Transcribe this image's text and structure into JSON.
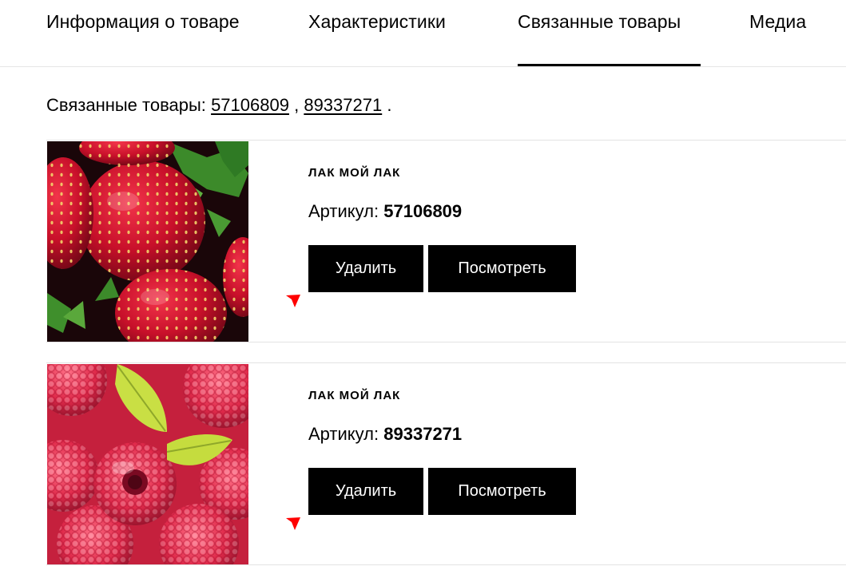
{
  "tabs": [
    {
      "label": "Информация о товаре",
      "active": false
    },
    {
      "label": "Характеристики",
      "active": false
    },
    {
      "label": "Связанные товары",
      "active": true
    },
    {
      "label": "Медиа",
      "active": false
    }
  ],
  "related": {
    "prefix": "Связанные товары:",
    "links": [
      "57106809",
      "89337271"
    ],
    "separator": ",",
    "suffix": "."
  },
  "products": [
    {
      "brand": "ЛАК МОЙ ЛАК",
      "sku_label": "Артикул:",
      "sku": "57106809",
      "image_icon": "strawberry-image",
      "delete_label": "Удалить",
      "view_label": "Посмотреть"
    },
    {
      "brand": "ЛАК МОЙ ЛАК",
      "sku_label": "Артикул:",
      "sku": "89337271",
      "image_icon": "raspberry-image",
      "delete_label": "Удалить",
      "view_label": "Посмотреть"
    }
  ],
  "colors": {
    "accent": "#000000",
    "marker": "#ff0000",
    "divider": "#e3e3e3"
  }
}
